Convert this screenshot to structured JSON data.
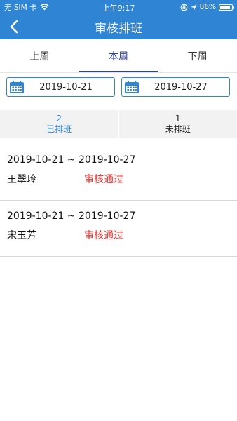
{
  "status_bar": {
    "carrier": "无 SIM 卡",
    "time": "上午9:17",
    "battery": "86%",
    "battery_level": 0.86
  },
  "nav": {
    "title": "审核排班",
    "back_icon": "chevron-left-icon"
  },
  "tabs": [
    {
      "label": "上周",
      "active": false
    },
    {
      "label": "本周",
      "active": true
    },
    {
      "label": "下周",
      "active": false
    }
  ],
  "dates": {
    "start": "2019-10-21",
    "end": "2019-10-27",
    "icon": "calendar-icon"
  },
  "counts": [
    {
      "number": "2",
      "label": "已排班",
      "active": true
    },
    {
      "number": "1",
      "label": "未排班",
      "active": false
    }
  ],
  "items": [
    {
      "range": "2019-10-21 ~ 2019-10-27",
      "name": "王翠玲",
      "status": "审核通过"
    },
    {
      "range": "2019-10-21 ~ 2019-10-27",
      "name": "宋玉芳",
      "status": "审核通过"
    }
  ],
  "colors": {
    "header": "#2f85d3",
    "tab_active": "#2f3fa8",
    "status_ok": "#e53935"
  }
}
